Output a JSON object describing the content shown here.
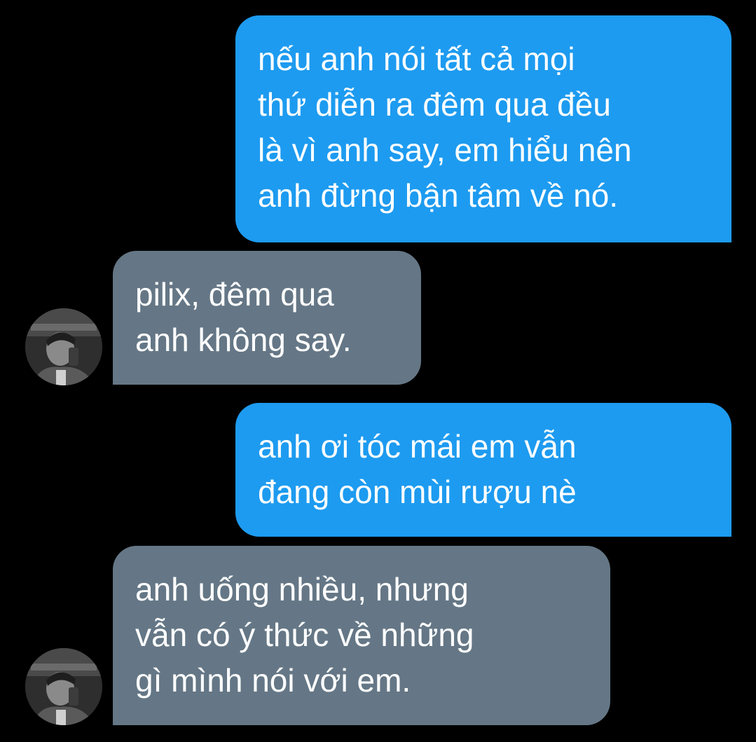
{
  "conversation": {
    "messages": [
      {
        "direction": "sent",
        "text": "nếu anh nói tất cả mọi\nthứ diễn ra đêm qua đều\nlà vì anh say, em hiểu nên\nanh đừng bận tâm về nó."
      },
      {
        "direction": "received",
        "text": "pilix, đêm qua\nanh không say."
      },
      {
        "direction": "sent",
        "text": "anh ơi tóc mái em vẫn\nđang còn mùi rượu nè"
      },
      {
        "direction": "received",
        "text": "anh uống nhiều, nhưng\nvẫn có ý thức về những\ngì mình nói với em."
      }
    ]
  },
  "colors": {
    "background": "#000000",
    "sent_bubble": "#1d9bf0",
    "received_bubble": "#657786",
    "text": "#ffffff"
  }
}
